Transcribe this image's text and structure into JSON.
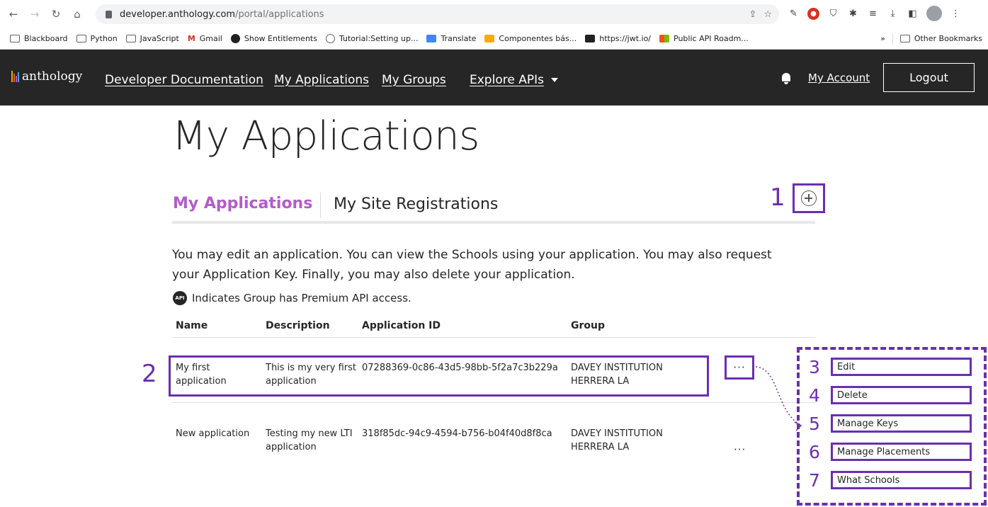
{
  "browser": {
    "url_host": "developer.anthology.com",
    "url_path": "/portal/applications",
    "bookmarks": [
      "Blackboard",
      "Python",
      "JavaScript",
      "Gmail",
      "Show Entitlements",
      "Tutorial:Setting up...",
      "Translate",
      "Componentes bás...",
      "https://jwt.io/",
      "Public API Roadm..."
    ],
    "overflow": "»",
    "other_bookmarks": "Other Bookmarks"
  },
  "header": {
    "logo": "anthology",
    "nav": [
      "Developer Documentation",
      "My Applications",
      "My Groups",
      "Explore APIs"
    ],
    "my_account": "My Account",
    "logout": "Logout"
  },
  "main": {
    "title": "My Applications",
    "tabs": [
      {
        "label": "My Applications",
        "active": true
      },
      {
        "label": "My Site Registrations",
        "active": false
      }
    ],
    "intro": "You may edit an application. You can view the Schools using your application. You may also request your Application Key. Finally, you may also delete your application.",
    "premium_badge": "API",
    "premium_note": "Indicates Group has Premium API access.",
    "table": {
      "headers": [
        "Name",
        "Description",
        "Application ID",
        "Group"
      ],
      "rows": [
        {
          "name": "My first application",
          "description": "This is my very first application",
          "app_id": "07288369-0c86-43d5-98bb-5f2a7c3b229a",
          "group": "DAVEY INSTITUTION HERRERA LA",
          "actions": "···"
        },
        {
          "name": "New application",
          "description": "Testing my new LTI application",
          "app_id": "318f85dc-94c9-4594-b756-b04f40d8f8ca",
          "group": "DAVEY INSTITUTION HERRERA LA",
          "actions": "···"
        }
      ]
    }
  },
  "annotations": {
    "numbers": [
      "1",
      "2",
      "3",
      "4",
      "5",
      "6",
      "7"
    ],
    "menu": [
      "Edit",
      "Delete",
      "Manage Keys",
      "Manage Placements",
      "What Schools"
    ],
    "annotation_color": "#6b2fae"
  },
  "colors": {
    "accent": "#b35cc9",
    "header_bg": "#262626"
  }
}
